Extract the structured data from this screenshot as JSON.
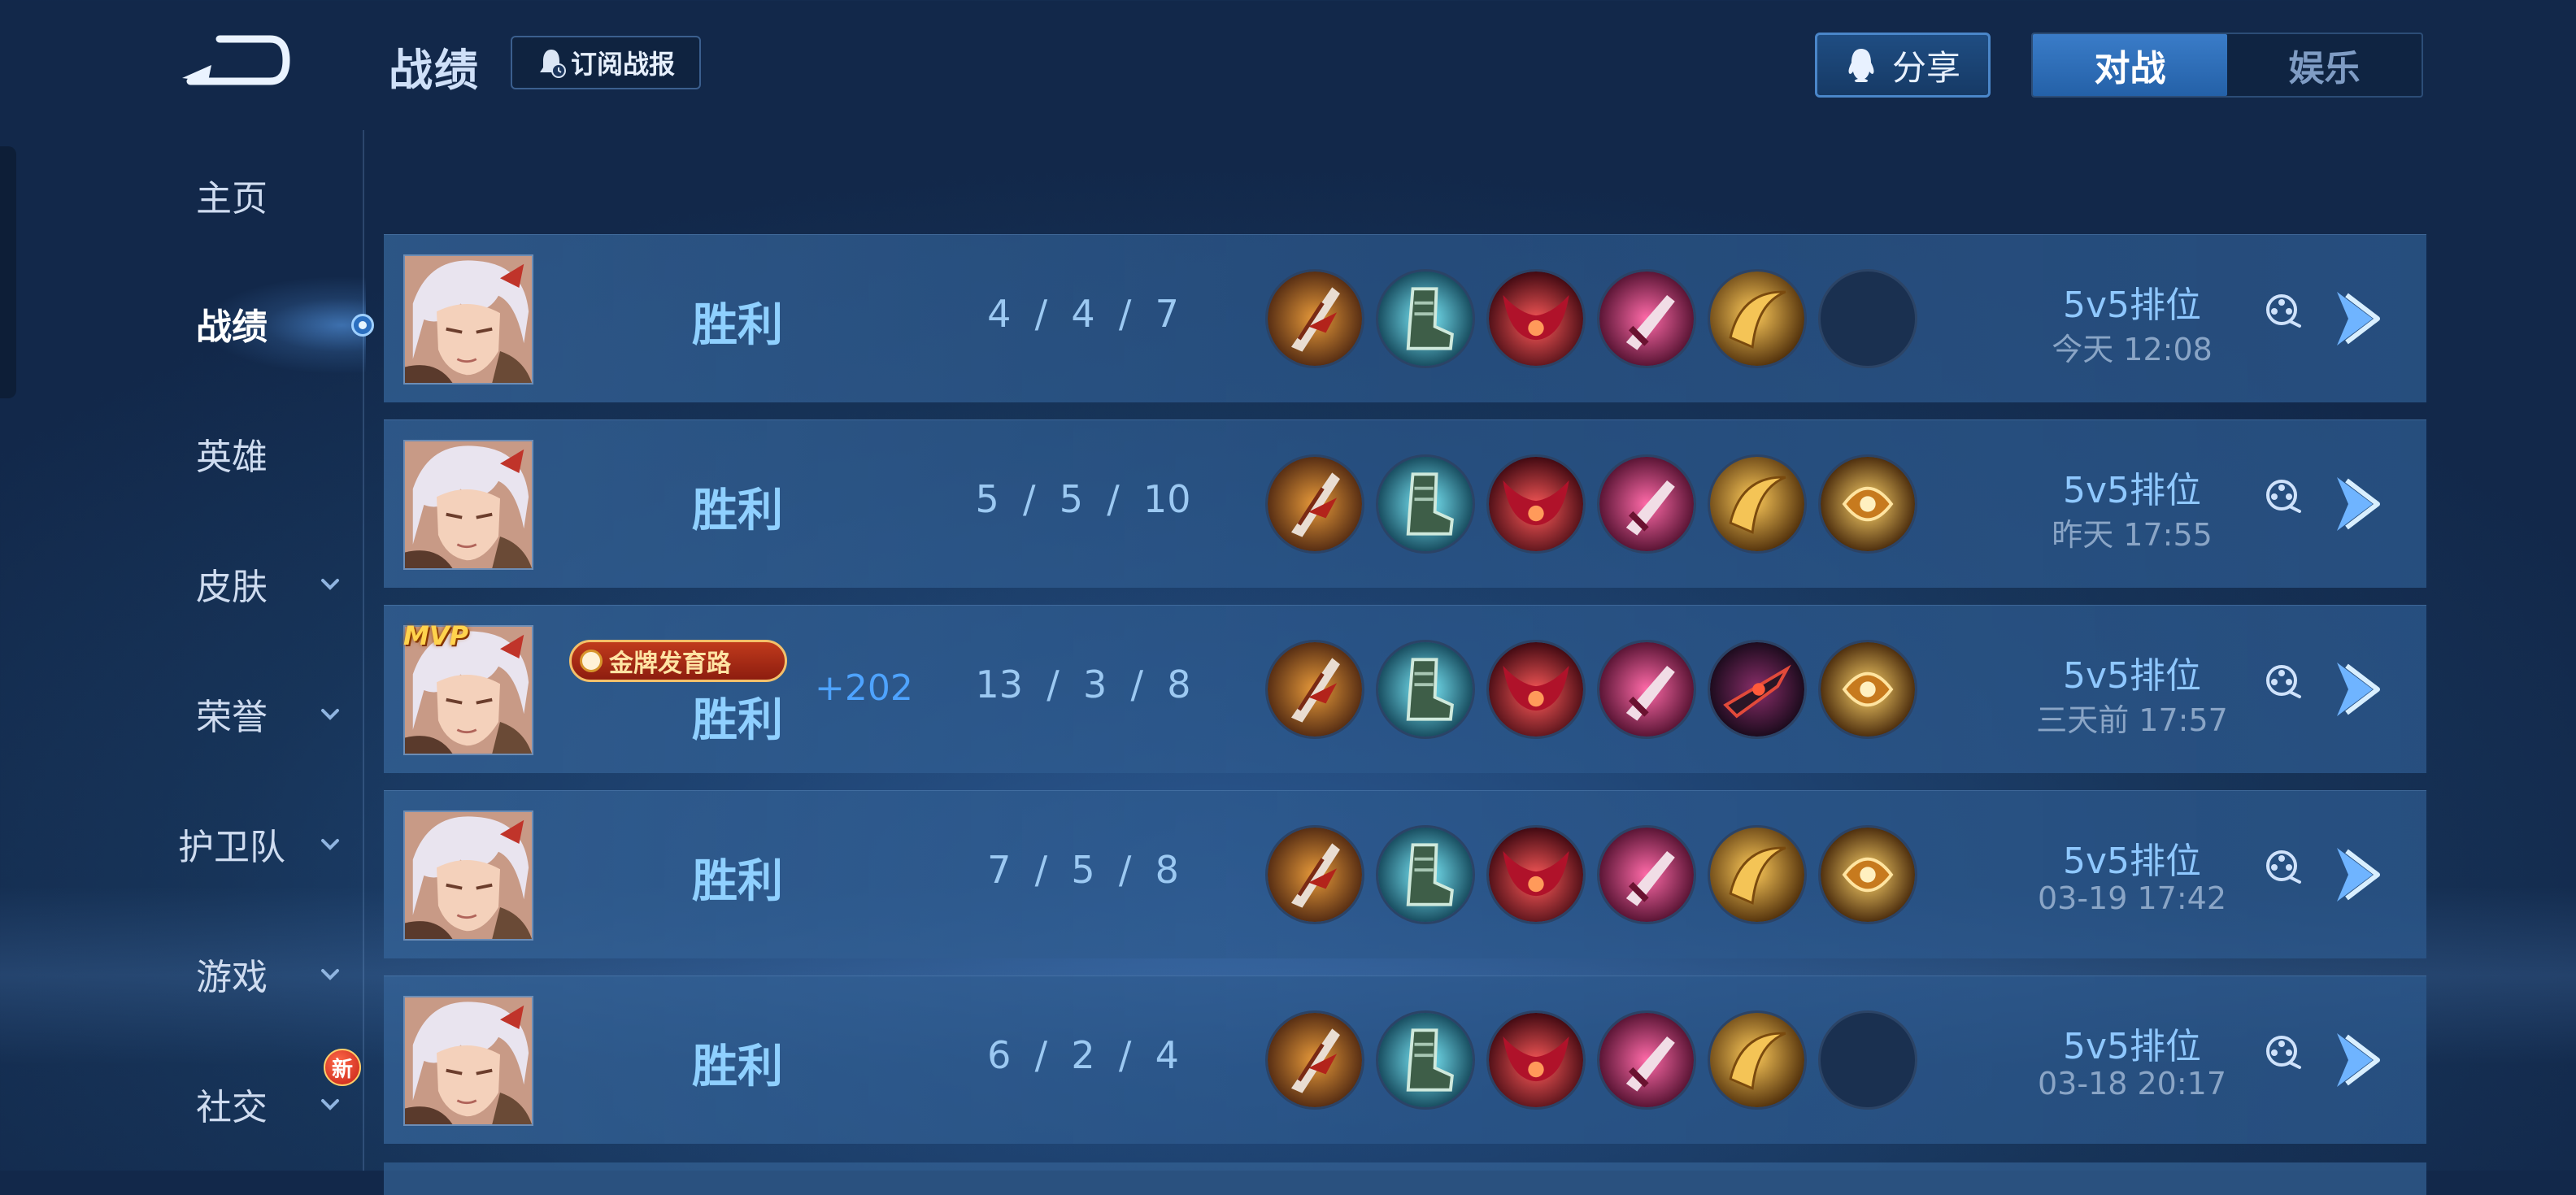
{
  "header": {
    "title": "战绩",
    "subscribe_label": "订阅战报",
    "share_label": "分享",
    "tabs": [
      {
        "label": "对战",
        "active": true
      },
      {
        "label": "娱乐",
        "active": false
      }
    ]
  },
  "sidebar": {
    "items": [
      {
        "label": "主页",
        "expandable": false
      },
      {
        "label": "战绩",
        "expandable": false,
        "active": true
      },
      {
        "label": "英雄",
        "expandable": false
      },
      {
        "label": "皮肤",
        "expandable": true
      },
      {
        "label": "荣誉",
        "expandable": true
      },
      {
        "label": "护卫队",
        "expandable": true
      },
      {
        "label": "游戏",
        "expandable": true
      },
      {
        "label": "社交",
        "expandable": true,
        "badge": "新"
      }
    ]
  },
  "matches": [
    {
      "result": "胜利",
      "kda": "4  /  4  /  7",
      "items": [
        "scythe",
        "boots",
        "crimson-mask",
        "pink-dagger",
        "golden-blade",
        "empty"
      ],
      "mode": "5v5排位",
      "time": "今天 12:08"
    },
    {
      "result": "胜利",
      "kda": "5  /  5  /  10",
      "items": [
        "scythe",
        "boots",
        "crimson-mask",
        "pink-dagger",
        "golden-blade",
        "gold-orb"
      ],
      "mode": "5v5排位",
      "time": "昨天 17:55"
    },
    {
      "result": "胜利",
      "mvp": "MVP",
      "title_badge": "金牌发育路",
      "score_gain": "+202",
      "kda": "13  /  3  /  8",
      "items": [
        "scythe",
        "boots",
        "crimson-mask",
        "pink-dagger",
        "dark-blade",
        "gold-orb"
      ],
      "mode": "5v5排位",
      "time": "三天前 17:57"
    },
    {
      "result": "胜利",
      "kda": "7  /  5  /  8",
      "items": [
        "scythe",
        "boots",
        "crimson-mask",
        "pink-dagger",
        "golden-blade",
        "gold-orb"
      ],
      "mode": "5v5排位",
      "time": "03-19  17:42"
    },
    {
      "result": "胜利",
      "kda": "6  /  2  /  4",
      "items": [
        "scythe",
        "boots",
        "crimson-mask",
        "pink-dagger",
        "golden-blade",
        "empty"
      ],
      "mode": "5v5排位",
      "time": "03-18  20:17"
    }
  ],
  "colors": {
    "accent": "#2461a8",
    "result_win": "#8fd0ff",
    "score_gain": "#4ea3ff",
    "badge_red": "#c03a1c"
  }
}
